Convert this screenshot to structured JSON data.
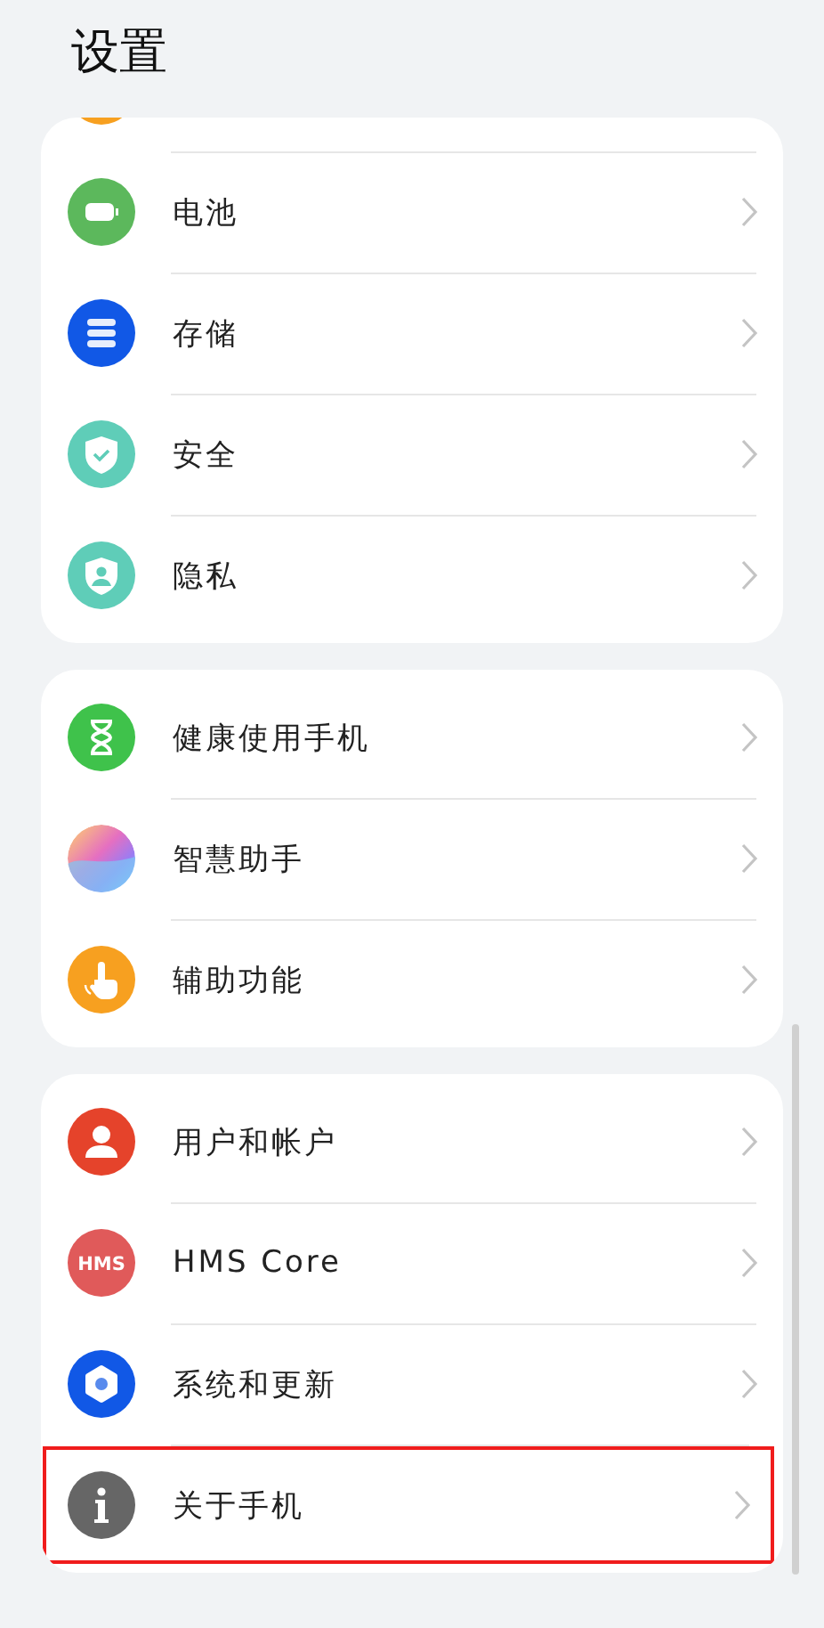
{
  "title": "设置",
  "groups": [
    {
      "clipped_top": true,
      "items": [
        {
          "label": "电池",
          "highlighted": false
        },
        {
          "label": "存储",
          "highlighted": false
        },
        {
          "label": "安全",
          "highlighted": false
        },
        {
          "label": "隐私",
          "highlighted": false
        }
      ]
    },
    {
      "clipped_top": false,
      "items": [
        {
          "label": "健康使用手机",
          "highlighted": false
        },
        {
          "label": "智慧助手",
          "highlighted": false
        },
        {
          "label": "辅助功能",
          "highlighted": false
        }
      ]
    },
    {
      "clipped_top": false,
      "items": [
        {
          "label": "用户和帐户",
          "highlighted": false
        },
        {
          "label": "HMS Core",
          "icon_text": "HMS",
          "highlighted": false
        },
        {
          "label": "系统和更新",
          "highlighted": false
        },
        {
          "label": "关于手机",
          "highlighted": true
        }
      ]
    }
  ]
}
